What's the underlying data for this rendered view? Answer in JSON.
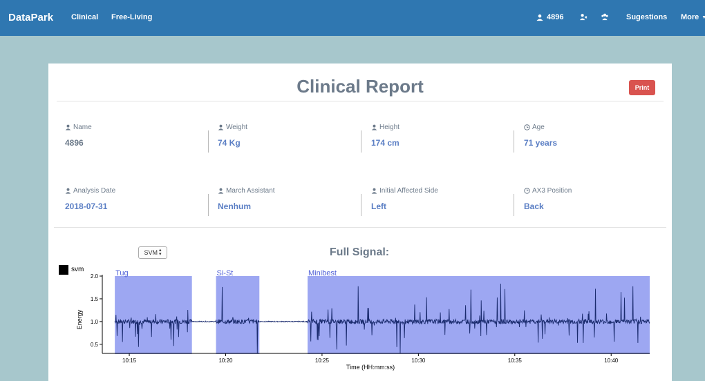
{
  "navbar": {
    "brand": "DataPark",
    "links": [
      "Clinical",
      "Free-Living"
    ],
    "user_id": "4896",
    "suggestions": "Sugestions",
    "more": "More"
  },
  "report": {
    "title": "Clinical Report",
    "print_label": "Print",
    "fields": [
      {
        "label": "Name",
        "value": "4896",
        "icon": "user-icon"
      },
      {
        "label": "Weight",
        "value": "74 Kg",
        "icon": "user-icon"
      },
      {
        "label": "Height",
        "value": "174 cm",
        "icon": "user-icon"
      },
      {
        "label": "Age",
        "value": "71 years",
        "icon": "clock-icon"
      },
      {
        "label": "Analysis Date",
        "value": "2018-07-31",
        "icon": "user-icon"
      },
      {
        "label": "March Assistant",
        "value": "Nenhum",
        "icon": "user-icon"
      },
      {
        "label": "Initial Affected Side",
        "value": "Left",
        "icon": "user-icon"
      },
      {
        "label": "AX3 Position",
        "value": "Back",
        "icon": "clock-icon"
      }
    ]
  },
  "signal": {
    "select_value": "SVM",
    "title": "Full Signal:"
  },
  "chart_data": {
    "type": "line",
    "legend": [
      "svm"
    ],
    "ylabel": "Energy",
    "xlabel": "Time (HH:mm:ss)",
    "ylim": [
      0.3,
      2.0
    ],
    "yticks": [
      "0.5",
      "1.0",
      "1.5",
      "2.0"
    ],
    "xticks": [
      "10:15",
      "10:20",
      "10:25",
      "10:30",
      "10:35",
      "10:40"
    ],
    "baseline": 1.0,
    "regions": [
      {
        "name": "Tug",
        "start": "10:14:15",
        "end": "10:18:15"
      },
      {
        "name": "Si-St",
        "start": "10:19:30",
        "end": "10:21:45"
      },
      {
        "name": "Minibest",
        "start": "10:24:15",
        "end": "10:42:00"
      }
    ],
    "colors": {
      "region": "#9da7f2",
      "signal": "#1a2b6e"
    }
  }
}
